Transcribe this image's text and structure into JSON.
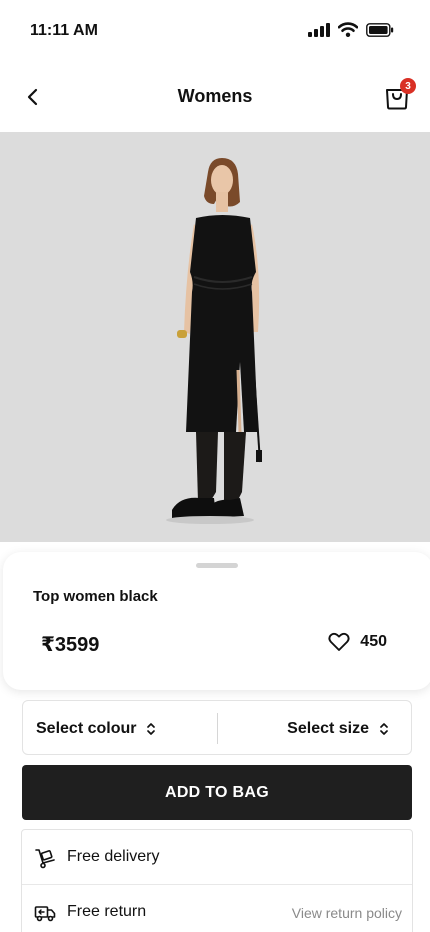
{
  "status": {
    "time": "11:11 AM"
  },
  "nav": {
    "title": "Womens",
    "cart_count": "3"
  },
  "product": {
    "title": "Top women black",
    "price": "₹3599",
    "likes": "450"
  },
  "selectors": {
    "colour_label": "Select colour",
    "size_label": "Select size"
  },
  "actions": {
    "add_to_bag": "ADD TO BAG"
  },
  "info": {
    "delivery": "Free delivery",
    "return": "Free return",
    "return_policy_link": "View return policy"
  },
  "colors": {
    "badge": "#d93025",
    "button": "#1f1f1f",
    "hero_bg": "#dcdcdc"
  },
  "icons": [
    "back-arrow-icon",
    "shopping-bag-icon",
    "heart-icon",
    "chevron-up-down-icon",
    "delivery-trolley-icon",
    "return-truck-icon",
    "signal-icon",
    "wifi-icon",
    "battery-icon"
  ]
}
